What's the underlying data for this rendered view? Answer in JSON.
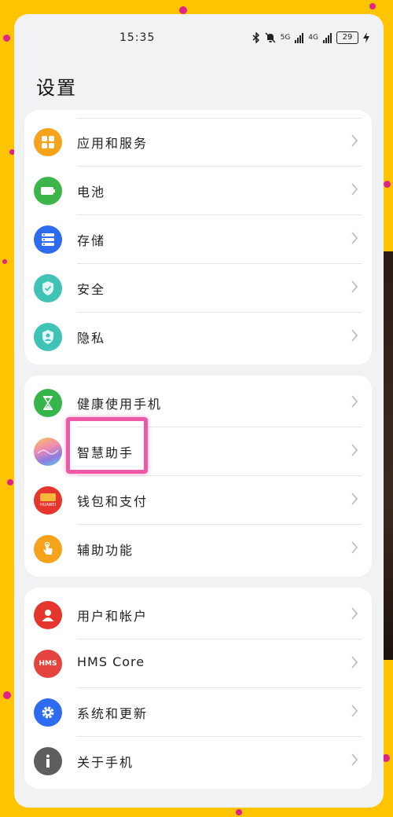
{
  "status_bar": {
    "time": "15:35",
    "network_5g": "5G",
    "network_4g": "4G",
    "battery": "29"
  },
  "page": {
    "title": "设置"
  },
  "groups": [
    {
      "items": [
        {
          "label": "应用和服务",
          "icon": "apps-grid-icon",
          "color": "#F5A31A"
        },
        {
          "label": "电池",
          "icon": "battery-icon",
          "color": "#3DB54A"
        },
        {
          "label": "存储",
          "icon": "storage-icon",
          "color": "#2D6BF0"
        },
        {
          "label": "安全",
          "icon": "shield-check-icon",
          "color": "#3FC3B7"
        },
        {
          "label": "隐私",
          "icon": "privacy-icon",
          "color": "#3FC3B7"
        }
      ]
    },
    {
      "items": [
        {
          "label": "健康使用手机",
          "icon": "hourglass-icon",
          "color": "#36B54B"
        },
        {
          "label": "智慧助手",
          "icon": "assistant-gradient-icon",
          "color": "#8E7BE0"
        },
        {
          "label": "钱包和支付",
          "icon": "huawei-wallet-icon",
          "color": "#E5352D",
          "badge": "HUAWEI"
        },
        {
          "label": "辅助功能",
          "icon": "hand-touch-icon",
          "color": "#F5A31A"
        }
      ]
    },
    {
      "items": [
        {
          "label": "用户和帐户",
          "icon": "user-icon",
          "color": "#E5352D"
        },
        {
          "label": "HMS Core",
          "icon": "hms-icon",
          "color": "#E5433D",
          "badge": "HMS"
        },
        {
          "label": "系统和更新",
          "icon": "gear-icon",
          "color": "#2D6BF0"
        },
        {
          "label": "关于手机",
          "icon": "info-icon",
          "color": "#5E5E5E"
        }
      ]
    }
  ]
}
